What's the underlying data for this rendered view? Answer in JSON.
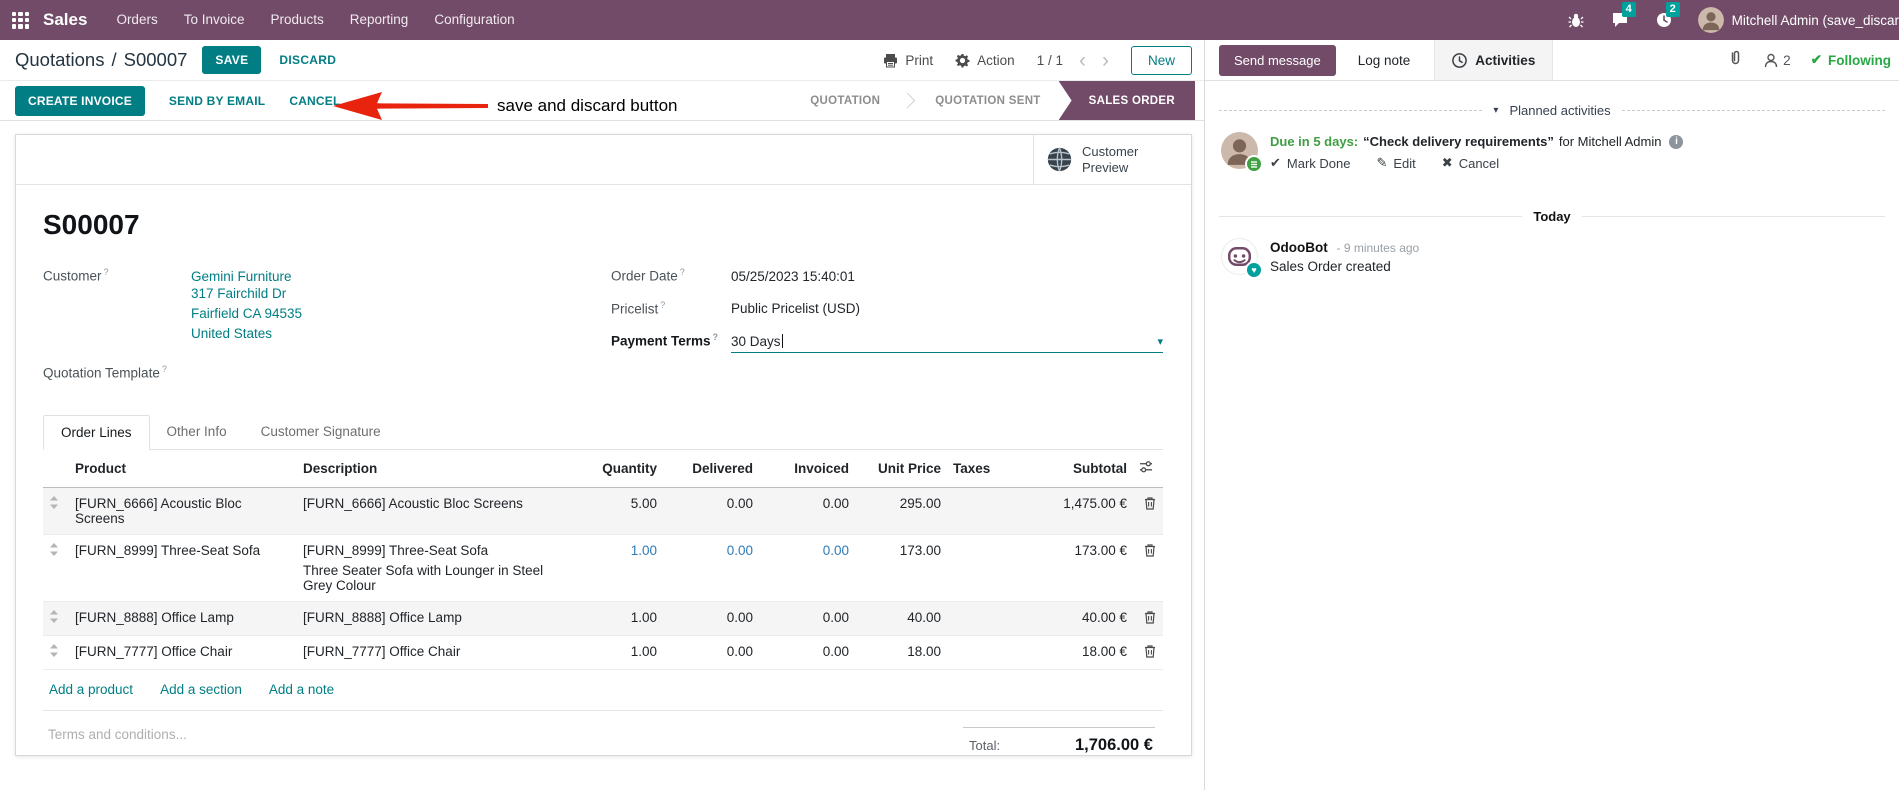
{
  "meta": {
    "help": "?"
  },
  "navbar": {
    "brand": "Sales",
    "menus": [
      "Orders",
      "To Invoice",
      "Products",
      "Reporting",
      "Configuration"
    ],
    "badges": {
      "messages": "4",
      "activities": "2"
    },
    "user": "Mitchell Admin (save_discar"
  },
  "control_panel": {
    "breadcrumb_parent": "Quotations",
    "breadcrumb_sep": "/",
    "breadcrumb_current": "S00007",
    "save": "SAVE",
    "discard": "DISCARD",
    "print": "Print",
    "action": "Action",
    "pager": "1 / 1",
    "prev": "‹",
    "next": "›",
    "new": "New"
  },
  "annotation": {
    "text": "save and discard button"
  },
  "statusbar": {
    "buttons": [
      "CREATE INVOICE",
      "SEND BY EMAIL",
      "CANCEL"
    ],
    "states": [
      "QUOTATION",
      "QUOTATION SENT",
      "SALES ORDER"
    ]
  },
  "form": {
    "customer_preview": "Customer Preview",
    "name": "S00007",
    "left": {
      "customer_label": "Customer",
      "customer_name": "Gemini Furniture",
      "address": [
        "317 Fairchild Dr",
        "Fairfield CA 94535",
        "United States"
      ],
      "quotation_template_label": "Quotation Template"
    },
    "right": {
      "order_date_label": "Order Date",
      "order_date": "05/25/2023 15:40:01",
      "pricelist_label": "Pricelist",
      "pricelist": "Public Pricelist (USD)",
      "payment_terms_label": "Payment Terms",
      "payment_terms": "30 Days",
      "dropdown_caret": "▾"
    },
    "tabs": [
      "Order Lines",
      "Other Info",
      "Customer Signature"
    ],
    "table": {
      "headers": [
        "Product",
        "Description",
        "Quantity",
        "Delivered",
        "Invoiced",
        "Unit Price",
        "Taxes",
        "Subtotal"
      ],
      "rows": [
        {
          "product": "[FURN_6666] Acoustic Bloc Screens",
          "desc": "[FURN_6666] Acoustic Bloc Screens",
          "qty": "5.00",
          "delivered": "0.00",
          "invoiced": "0.00",
          "unit_price": "295.00",
          "subtotal": "1,475.00 €"
        },
        {
          "product": "[FURN_8999] Three-Seat Sofa",
          "desc": "[FURN_8999] Three-Seat Sofa",
          "desc2": "Three Seater Sofa with Lounger in Steel Grey Colour",
          "qty": "1.00",
          "delivered": "0.00",
          "invoiced": "0.00",
          "unit_price": "173.00",
          "subtotal": "173.00 €"
        },
        {
          "product": "[FURN_8888] Office Lamp",
          "desc": "[FURN_8888] Office Lamp",
          "qty": "1.00",
          "delivered": "0.00",
          "invoiced": "0.00",
          "unit_price": "40.00",
          "subtotal": "40.00 €"
        },
        {
          "product": "[FURN_7777] Office Chair",
          "desc": "[FURN_7777] Office Chair",
          "qty": "1.00",
          "delivered": "0.00",
          "invoiced": "0.00",
          "unit_price": "18.00",
          "subtotal": "18.00 €"
        }
      ],
      "footer_links": [
        "Add a product",
        "Add a section",
        "Add a note"
      ]
    },
    "terms_placeholder": "Terms and conditions...",
    "total_label": "Total:",
    "total_value": "1,706.00 €"
  },
  "chatter": {
    "send_message": "Send message",
    "log_note": "Log note",
    "activities": "Activities",
    "followers_count": "2",
    "following": "Following",
    "planned_header": "Planned activities",
    "activity": {
      "due": "Due in 5 days:",
      "title": "“Check delivery requirements”",
      "for_text": "for Mitchell Admin",
      "mark_done": "Mark Done",
      "edit": "Edit",
      "cancel": "Cancel",
      "info": "i"
    },
    "today": "Today",
    "message": {
      "author": "OdooBot",
      "time": "- 9 minutes ago",
      "body": "Sales Order created"
    }
  },
  "colors": {
    "navbar": "#714B67",
    "primary_teal": "#017e84",
    "badge_teal": "#00A09D",
    "active_state_purple": "#714B67",
    "edited_blue": "#2e7ab5",
    "green": "#3f9e43",
    "annotation_red": "#e8240f"
  }
}
